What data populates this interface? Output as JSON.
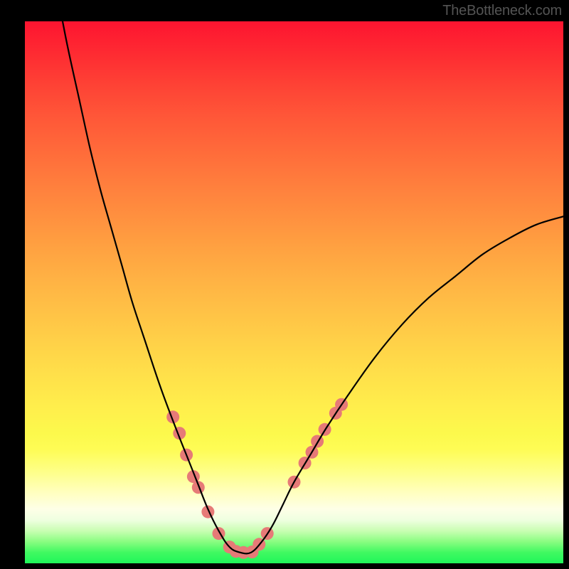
{
  "watermark": "TheBottleneck.com",
  "chart_data": {
    "type": "line",
    "title": "",
    "xlabel": "",
    "ylabel": "",
    "xlim": [
      0,
      100
    ],
    "ylim": [
      0,
      100
    ],
    "grid": false,
    "legend": false,
    "description": "V-shaped bottleneck curve over rainbow gradient; minimum near x≈39; salmon dot markers clustered along the lower flanks and valley",
    "series": [
      {
        "name": "curve",
        "color": "#000000",
        "x": [
          7,
          8,
          10,
          12,
          14,
          16,
          18,
          20,
          22,
          25,
          28,
          30,
          32,
          34,
          36,
          38,
          40,
          42,
          44,
          46,
          48,
          50,
          53,
          56,
          60,
          65,
          70,
          75,
          80,
          85,
          90,
          95,
          100
        ],
        "values": [
          100,
          95,
          86,
          77,
          69,
          62,
          55,
          48,
          42,
          33,
          25,
          20,
          15,
          10,
          6,
          3,
          2,
          2,
          4,
          7,
          11,
          15,
          20,
          25,
          31,
          38,
          44,
          49,
          53,
          57,
          60,
          62.5,
          64
        ]
      }
    ],
    "markers": {
      "name": "dots",
      "color": "#e67a77",
      "radius_px": 9,
      "points": [
        {
          "x": 27.5,
          "y": 27
        },
        {
          "x": 28.7,
          "y": 24
        },
        {
          "x": 30.0,
          "y": 20
        },
        {
          "x": 31.3,
          "y": 16
        },
        {
          "x": 32.2,
          "y": 14
        },
        {
          "x": 34.0,
          "y": 9.5
        },
        {
          "x": 36.0,
          "y": 5.5
        },
        {
          "x": 38.0,
          "y": 3
        },
        {
          "x": 39.2,
          "y": 2.2
        },
        {
          "x": 40.6,
          "y": 2
        },
        {
          "x": 42.2,
          "y": 2.1
        },
        {
          "x": 43.5,
          "y": 3.5
        },
        {
          "x": 45.0,
          "y": 5.5
        },
        {
          "x": 50.0,
          "y": 15
        },
        {
          "x": 52.0,
          "y": 18.5
        },
        {
          "x": 53.3,
          "y": 20.5
        },
        {
          "x": 54.3,
          "y": 22.5
        },
        {
          "x": 55.7,
          "y": 24.7
        },
        {
          "x": 57.7,
          "y": 27.7
        },
        {
          "x": 58.8,
          "y": 29.3
        }
      ]
    }
  }
}
